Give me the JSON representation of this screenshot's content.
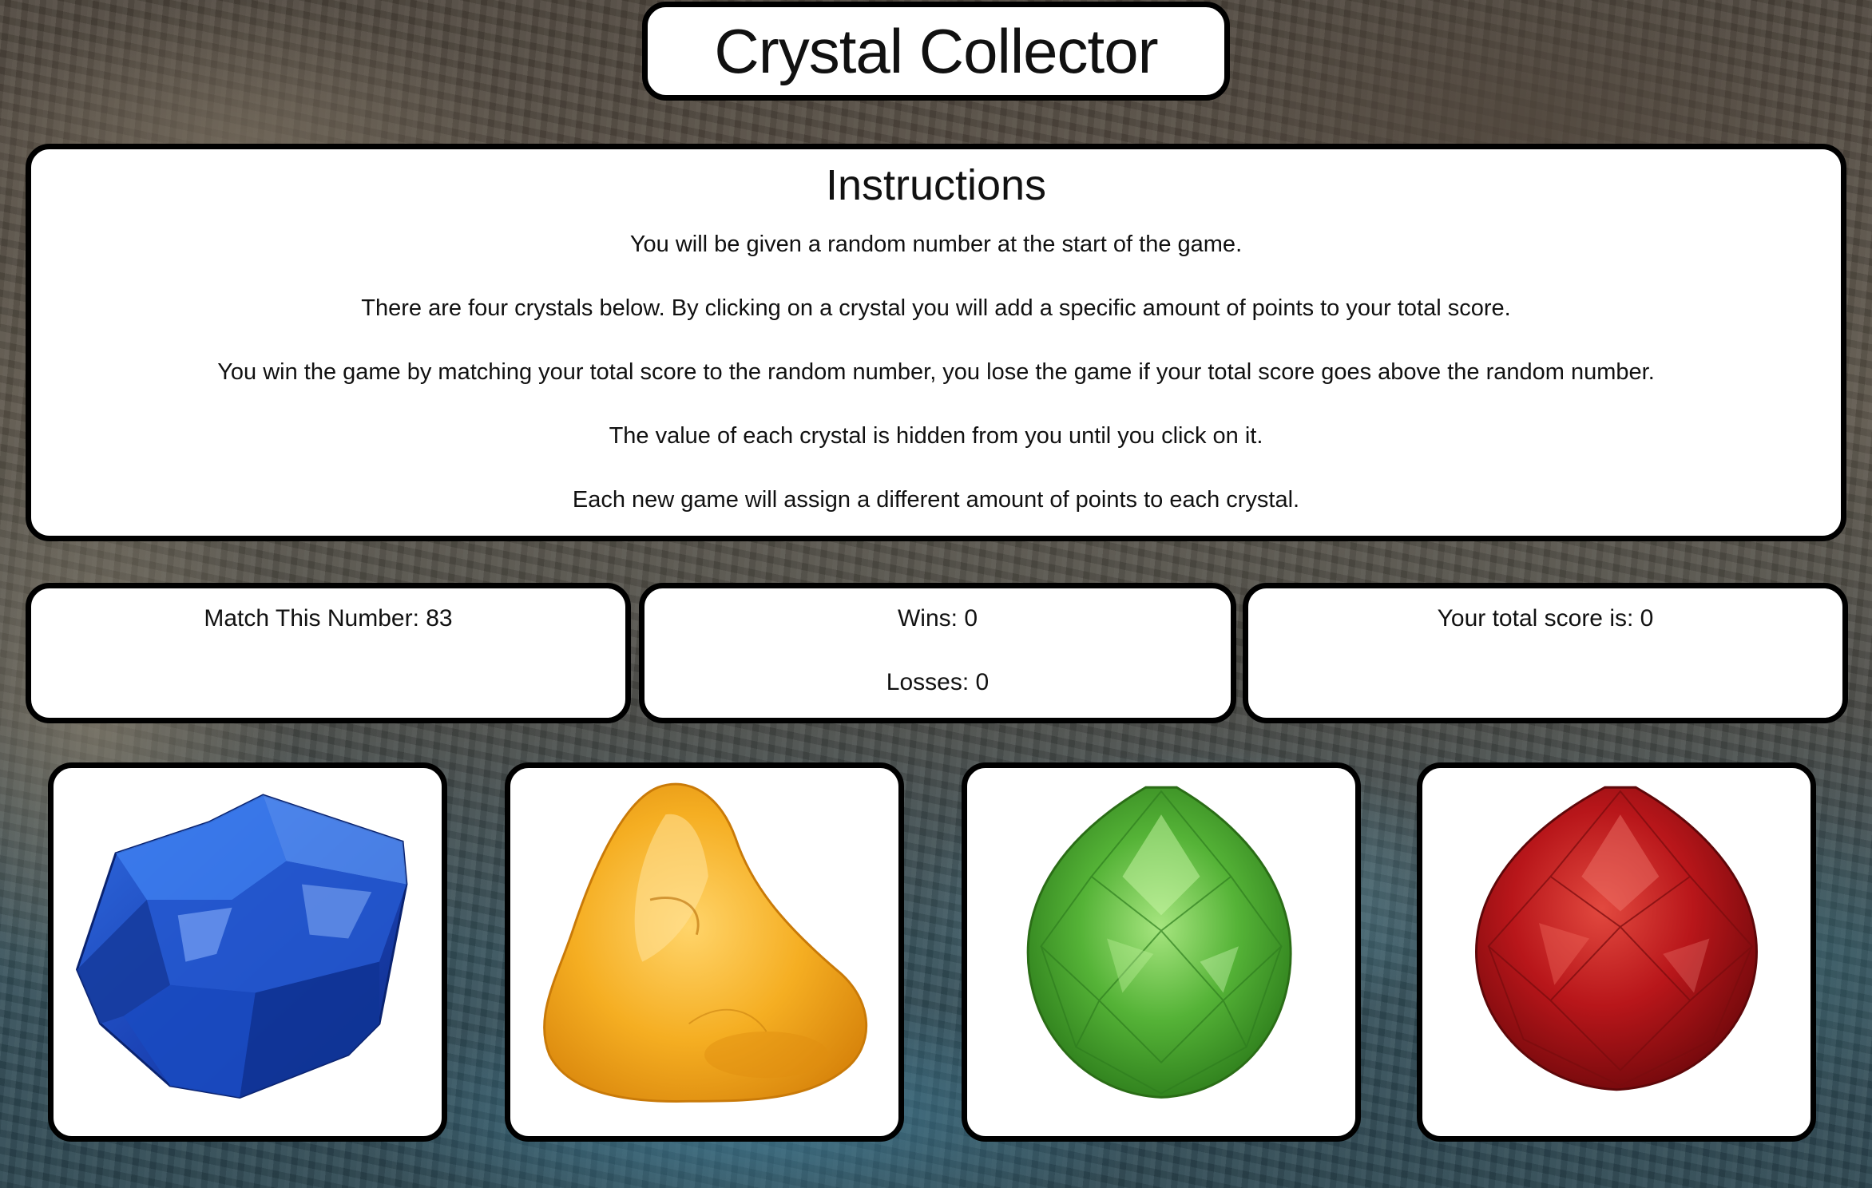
{
  "app": {
    "title": "Crystal Collector"
  },
  "instructions": {
    "heading": "Instructions",
    "lines": [
      "You will be given a random number at the start of the game.",
      "There are four crystals below. By clicking on a crystal you will add a specific amount of points to your total score.",
      "You win the game by matching your total score to the random number, you lose the game if your total score goes above the random number.",
      "The value of each crystal is hidden from you until you click on it.",
      "Each new game will assign a different amount of points to each crystal."
    ]
  },
  "stats": {
    "target_label": "Match This Number: 83",
    "wins_label": "Wins: 0",
    "losses_label": "Losses: 0",
    "score_label": "Your total score is: 0"
  },
  "crystals": [
    {
      "name": "blue-crystal",
      "color": "#1f4fc4"
    },
    {
      "name": "amber-crystal",
      "color": "#f2a81c"
    },
    {
      "name": "green-crystal",
      "color": "#3f9f2a"
    },
    {
      "name": "red-crystal",
      "color": "#b8161a"
    }
  ]
}
